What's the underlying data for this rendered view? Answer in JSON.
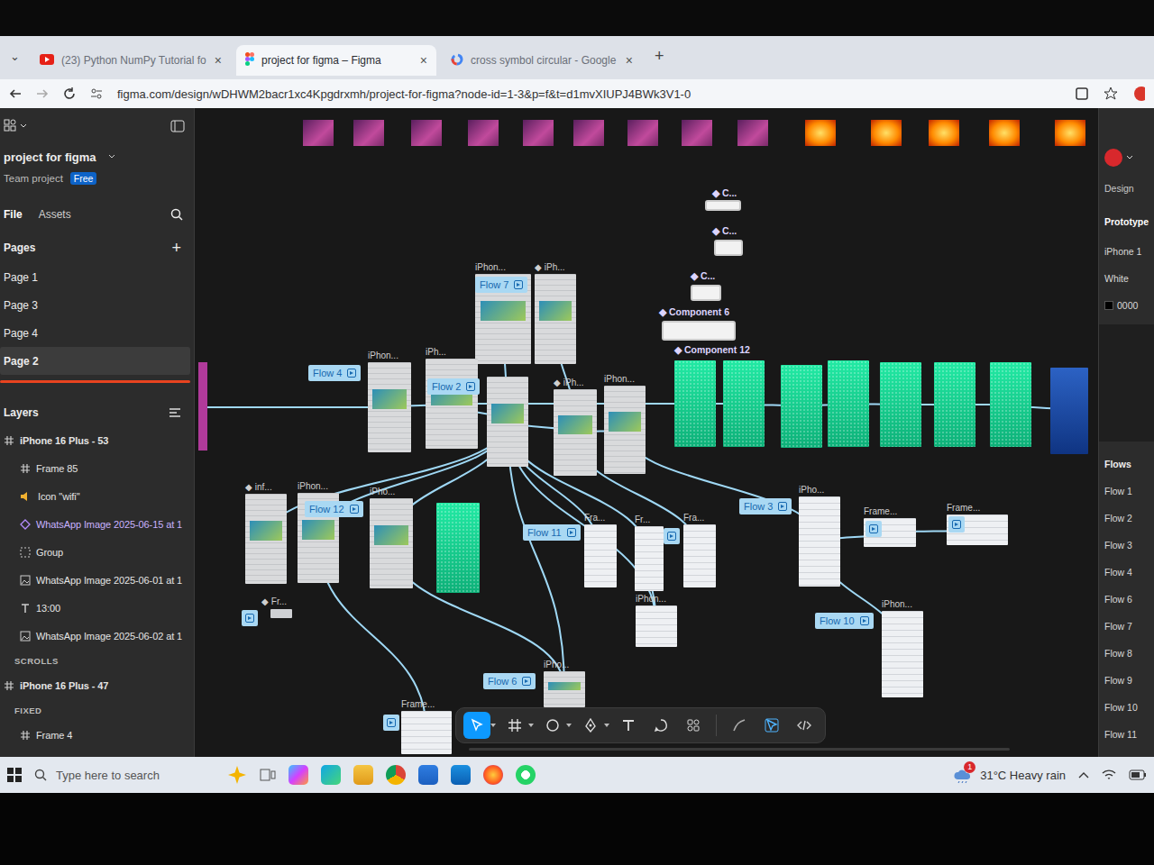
{
  "browser": {
    "menu": "⌄",
    "tabs": [
      {
        "label": "(23) Python NumPy Tutorial fo",
        "close": "×",
        "selected": false,
        "kind": "youtube"
      },
      {
        "label": "project for figma – Figma",
        "close": "×",
        "selected": true,
        "kind": "figma"
      },
      {
        "label": "cross symbol circular - Google",
        "close": "×",
        "selected": false,
        "kind": "google"
      }
    ],
    "new_tab": "+",
    "url": "figma.com/design/wDHWM2bacr1xc4Kpgdrxmh/project-for-figma?node-id=1-3&p=f&t=d1mvXIUPJ4BWk3V1-0"
  },
  "file": {
    "name": "project for figma",
    "team": "Team project",
    "plan": "Free"
  },
  "panel_tabs": [
    {
      "label": "File",
      "selected": true
    },
    {
      "label": "Assets",
      "selected": false
    }
  ],
  "pages": {
    "title": "Pages",
    "add": "+",
    "items": [
      {
        "label": "Page 1",
        "selected": false
      },
      {
        "label": "Page 3",
        "selected": false
      },
      {
        "label": "Page 4",
        "selected": false
      },
      {
        "label": "Page 2",
        "selected": true
      }
    ]
  },
  "layers": {
    "title": "Layers",
    "items": [
      {
        "label": "iPhone 16 Plus - 53",
        "kind": "root"
      },
      {
        "label": "Frame 85",
        "kind": "frame"
      },
      {
        "label": "Icon \"wifi\"",
        "kind": "icon"
      },
      {
        "label": "WhatsApp Image 2025-06-15 at 1",
        "kind": "component"
      },
      {
        "label": "Group",
        "kind": "group"
      },
      {
        "label": "WhatsApp Image 2025-06-01 at 1",
        "kind": "image"
      },
      {
        "label": "13:00",
        "kind": "text"
      },
      {
        "label": "WhatsApp Image 2025-06-02 at 1",
        "kind": "image"
      },
      {
        "label": "SCROLLS",
        "kind": "heading"
      },
      {
        "label": "iPhone 16 Plus - 47",
        "kind": "root"
      },
      {
        "label": "FIXED",
        "kind": "heading"
      },
      {
        "label": "Frame 4",
        "kind": "frame"
      }
    ]
  },
  "canvas": {
    "nodes": [
      {
        "label": "iPhon...",
        "kind": "phone"
      },
      {
        "label": "◆ iPh...",
        "kind": "phone"
      },
      {
        "label": "iPhon...",
        "kind": "phone"
      },
      {
        "label": "iPh...",
        "kind": "phone"
      },
      {
        "kind": "phone"
      },
      {
        "label": "◆ iPh...",
        "kind": "phone"
      },
      {
        "label": "iPhon...",
        "kind": "phone"
      },
      {
        "label": "◆ inf...",
        "kind": "phone"
      },
      {
        "label": "iPhon...",
        "kind": "phone"
      },
      {
        "label": "iPho...",
        "kind": "phone"
      },
      {
        "kind": "green"
      },
      {
        "label": "Fra...",
        "kind": "frame"
      },
      {
        "label": "Fr...",
        "kind": "frame"
      },
      {
        "label": "Fra...",
        "kind": "frame"
      },
      {
        "label": "iPho...",
        "kind": "frame"
      },
      {
        "label": "Frame...",
        "kind": "frame"
      },
      {
        "label": "Frame...",
        "kind": "frame"
      },
      {
        "label": "iPhon...",
        "kind": "frame"
      },
      {
        "label": "iPhon...",
        "kind": "frame"
      },
      {
        "label": "iPho...",
        "kind": "phone"
      },
      {
        "label": "Frame...",
        "kind": "frame"
      },
      {
        "label": "◆ Fr...",
        "kind": "small"
      },
      {
        "kind": "green"
      },
      {
        "kind": "green"
      },
      {
        "kind": "green"
      },
      {
        "kind": "green"
      },
      {
        "kind": "green"
      },
      {
        "kind": "green"
      },
      {
        "kind": "green"
      },
      {
        "kind": "poster"
      }
    ],
    "flows": [
      "Flow 7",
      "Flow 4",
      "Flow 2",
      "Flow 12",
      "Flow 11",
      "Flow 3",
      "Flow 10",
      "Flow 6"
    ],
    "components": [
      "◆ C...",
      "◆ C...",
      "◆ C...",
      "◆ Component 6",
      "◆ Component 12"
    ],
    "links": [
      [
        2,
        3
      ],
      [
        3,
        4
      ],
      [
        0,
        4
      ],
      [
        1,
        5
      ],
      [
        4,
        5
      ],
      [
        5,
        6
      ],
      [
        4,
        7
      ],
      [
        4,
        8
      ],
      [
        4,
        9
      ],
      [
        4,
        11
      ],
      [
        4,
        12
      ],
      [
        5,
        13
      ],
      [
        4,
        18
      ],
      [
        4,
        19
      ],
      [
        8,
        20
      ],
      [
        6,
        14
      ],
      [
        14,
        15
      ],
      [
        15,
        16
      ],
      [
        14,
        17
      ],
      [
        12,
        18
      ],
      [
        3,
        22
      ],
      [
        9,
        19
      ],
      [
        22,
        23
      ],
      [
        23,
        24
      ],
      [
        24,
        25
      ],
      [
        25,
        26
      ],
      [
        26,
        27
      ],
      [
        27,
        28
      ],
      [
        28,
        29
      ]
    ]
  },
  "toolbar": {
    "tools": [
      {
        "kind": "move",
        "selected": true
      },
      {
        "kind": "frame",
        "selected": false
      },
      {
        "kind": "shape",
        "selected": false
      },
      {
        "kind": "pen",
        "selected": false
      },
      {
        "kind": "text",
        "selected": false
      },
      {
        "kind": "comment",
        "selected": false
      },
      {
        "kind": "actions",
        "selected": false
      },
      {
        "kind": "draw",
        "selected": false
      },
      {
        "kind": "prototype",
        "selected": false
      },
      {
        "kind": "dev",
        "selected": false
      }
    ]
  },
  "right_panel": {
    "tabs": [
      {
        "label": "Design",
        "selected": false
      },
      {
        "label": "Prototype",
        "selected": true
      }
    ],
    "device": "iPhone 1",
    "color": "White",
    "value": "0000",
    "flows_title": "Flows",
    "flows": [
      "Flow 1",
      "Flow 2",
      "Flow 3",
      "Flow 4",
      "Flow 6",
      "Flow 7",
      "Flow 8",
      "Flow 9",
      "Flow 10",
      "Flow 11"
    ]
  },
  "taskbar": {
    "search": "Type here to search",
    "weather": "31°C Heavy rain",
    "badge": "1"
  }
}
